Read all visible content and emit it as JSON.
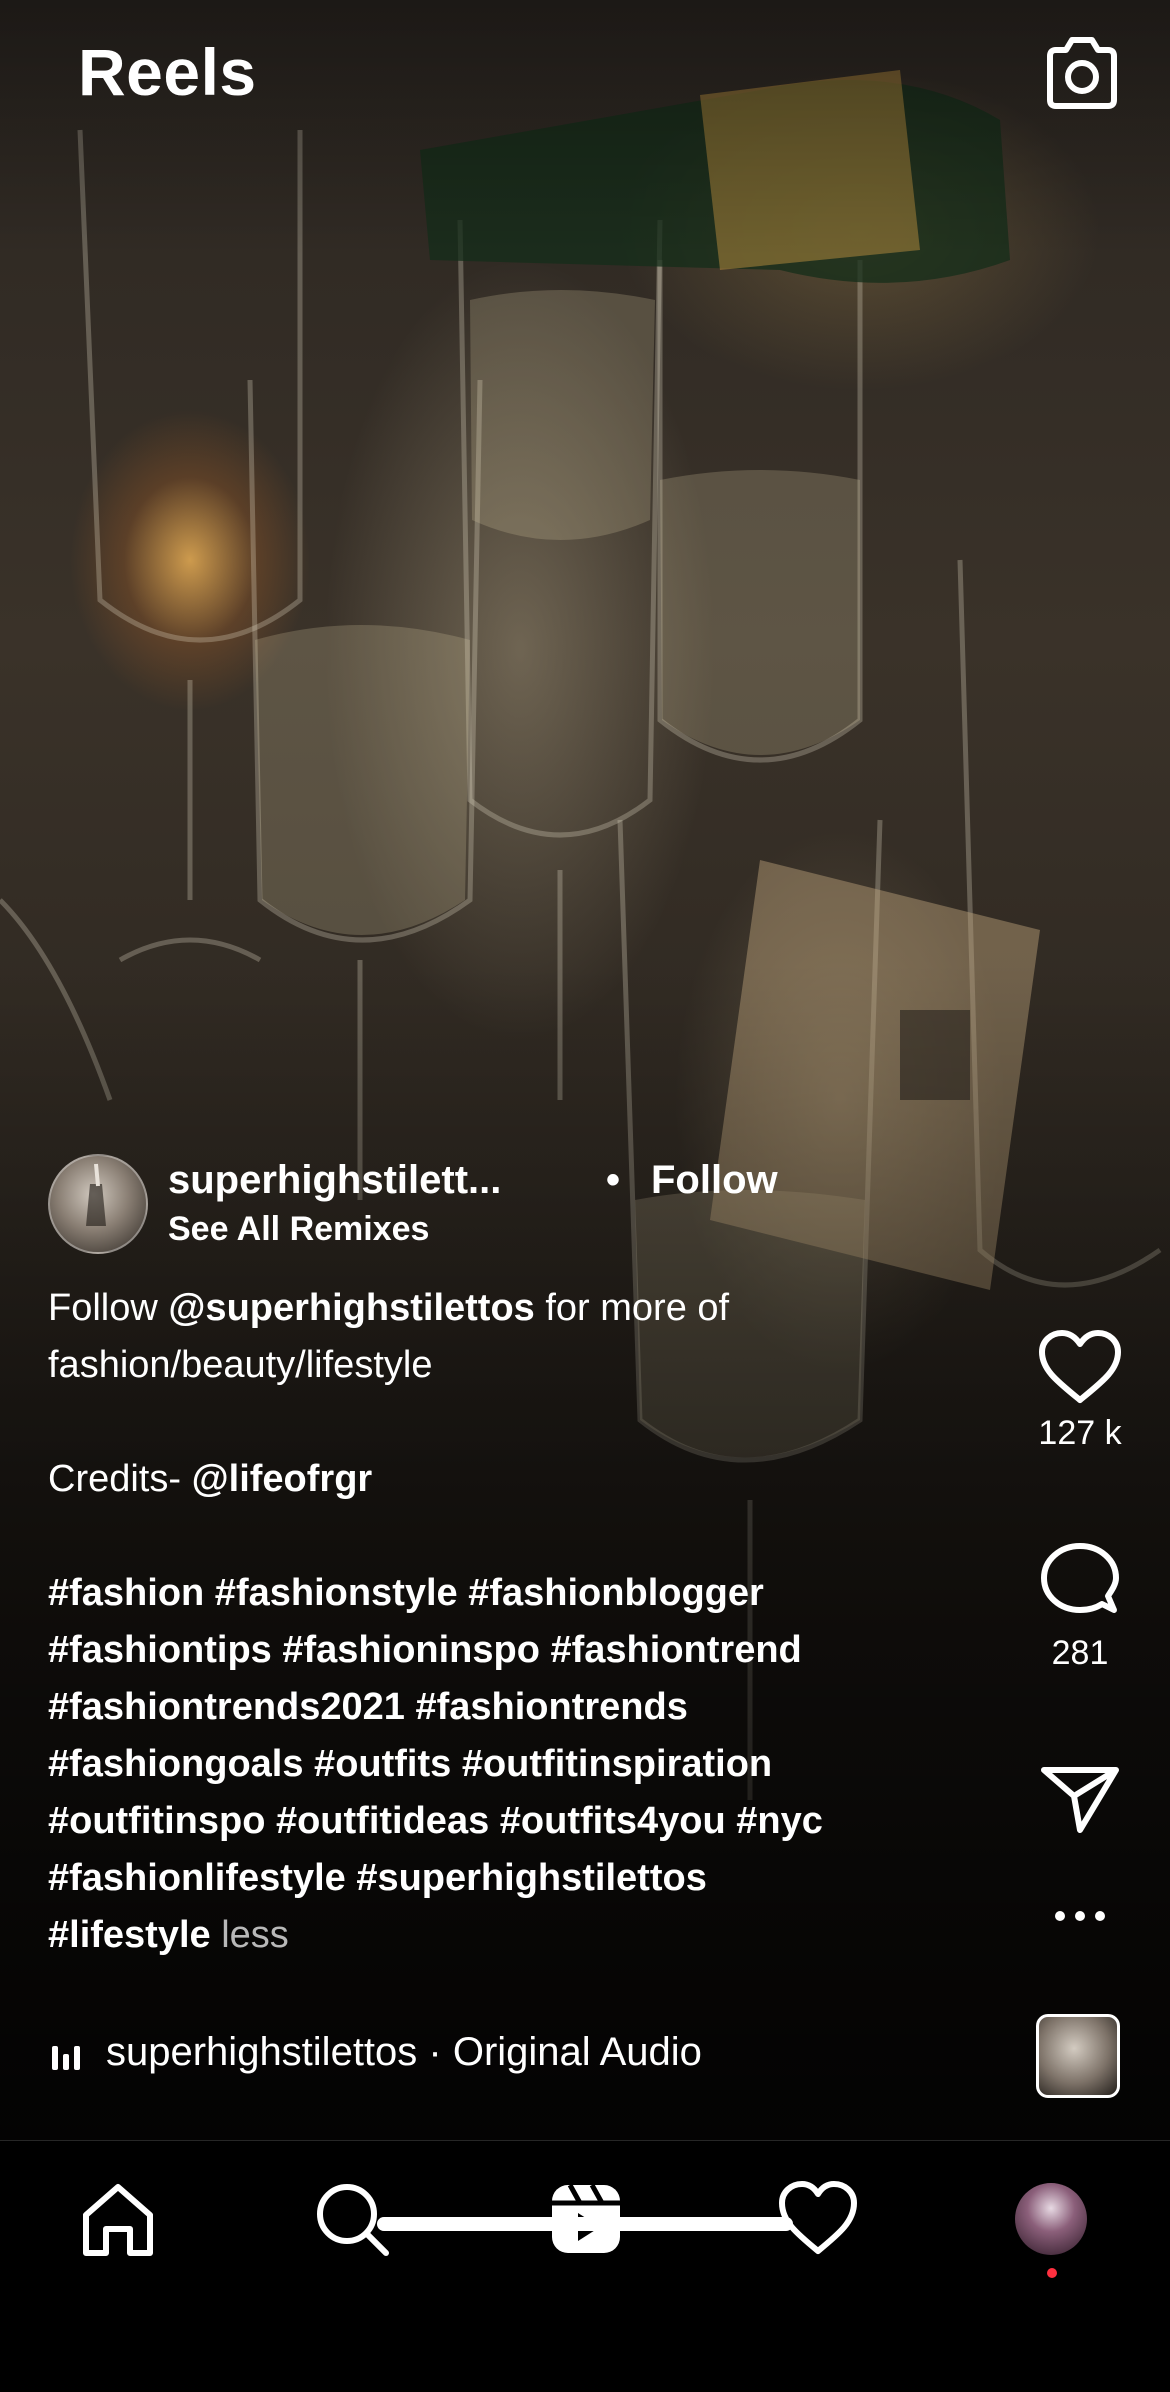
{
  "header": {
    "title": "Reels",
    "camera_icon": "camera-icon"
  },
  "post": {
    "author": "superhighstilett...",
    "separator": "•",
    "follow_label": "Follow",
    "remixes_label": "See All Remixes",
    "caption": {
      "line1_prefix": "Follow ",
      "line1_mention": "@superhighstilettos",
      "line1_suffix": " for more of",
      "line2": "fashion/beauty/lifestyle",
      "credits_prefix": "Credits- ",
      "credits_mention": "@lifeofrgr",
      "hashtags": [
        "#fashion #fashionstyle #fashionblogger",
        "#fashiontips #fashioninspo  #fashiontrend",
        "#fashiontrends2021 #fashiontrends",
        "#fashiongoals #outfits #outfitinspiration",
        "#outfitinspo #outfitideas #outfits4you  #nyc",
        "#fashionlifestyle #superhighstilettos"
      ],
      "last_tag": "#lifestyle",
      "less_label": " less"
    },
    "audio": {
      "text": "superhighstilettos · Original Audio"
    }
  },
  "actions": {
    "likes": "127 k",
    "comments": "281"
  },
  "nav": {
    "items": [
      "home-icon",
      "search-icon",
      "reels-icon",
      "activity-heart-icon",
      "profile-avatar"
    ]
  },
  "colors": {
    "notification_dot": "#ff3040",
    "background": "#000000"
  }
}
